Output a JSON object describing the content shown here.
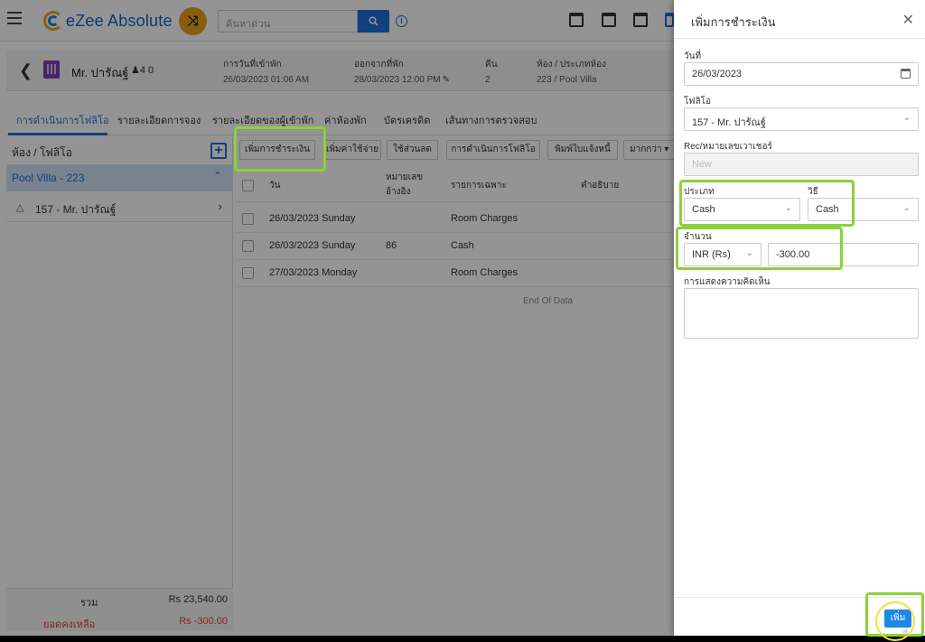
{
  "app": {
    "brand": "eZee Absolute"
  },
  "search": {
    "placeholder": "ค้นหาด่วน"
  },
  "guest": {
    "name": "Mr. ปารัณฐ์",
    "pax": "4  0",
    "checkin_label": "การวันที่เข้าพัก",
    "checkin_value": "26/03/2023 01:06 AM",
    "checkout_label": "ออกจากที่พัก",
    "checkout_value": "28/03/2023 12:00 PM",
    "nights_label": "คืน",
    "nights_value": "2",
    "room_label": "ห้อง / ประเภทห้อง",
    "room_value": "223 / Pool Villa"
  },
  "tabs": [
    "การดำเนินการโฟลิโอ",
    "รายละเอียดการจอง",
    "รายละเอียดของผู้เข้าพัก",
    "ค่าห้องพัก",
    "บัตรเครดิต",
    "เส้นทางการตรวจสอบ"
  ],
  "left_panel": {
    "title": "ห้อง / โฟลิโอ",
    "room": "Pool Villa - 223",
    "folio": "157 - Mr. ปารัณฐ์",
    "total_label": "รวม",
    "total_value": "Rs 23,540.00",
    "balance_label": "ยอดคงเหลือ",
    "balance_value": "Rs -300.00"
  },
  "actions": [
    "เพิ่มการชำระเงิน",
    "เพิ่มค่าใช้จ่าย",
    "ใช้ส่วนลด",
    "การดำเนินการโฟลิโอ",
    "พิมพ์ใบแจ้งหนี้",
    "มากกว่า"
  ],
  "table": {
    "headers": {
      "date": "วัน",
      "ref_line1": "หมายเลข",
      "ref_line2": "อ้างอิง",
      "particulars": "รายการเฉพาะ",
      "description": "คำอธิบาย"
    },
    "rows": [
      {
        "date": "26/03/2023 Sunday",
        "ref": "",
        "particulars": "Room Charges"
      },
      {
        "date": "26/03/2023 Sunday",
        "ref": "86",
        "particulars": "Cash"
      },
      {
        "date": "27/03/2023 Monday",
        "ref": "",
        "particulars": "Room Charges"
      }
    ],
    "end_text": "End Of Data"
  },
  "drawer": {
    "title": "เพิ่มการชำระเงิน",
    "date_label": "วันที่",
    "date_value": "26/03/2023",
    "folio_label": "โฟลิโอ",
    "folio_value": "157 - Mr. ปารัณฐ์",
    "voucher_label": "Rec/หมายเลขเวาเชอร์",
    "voucher_value": "New",
    "type_label": "ประเภท",
    "type_value": "Cash",
    "method_label": "วิธี",
    "method_value": "Cash",
    "amount_label": "จำนวน",
    "currency_value": "INR (Rs)",
    "amount_value": "-300.00",
    "comment_label": "การแสดงความคิดเห็น",
    "add_button": "เพิ่ม"
  },
  "colors": {
    "accent": "#1e6fd9",
    "highlight": "#8bd13a",
    "balance": "#e53935",
    "shuffle": "#e8a317"
  }
}
